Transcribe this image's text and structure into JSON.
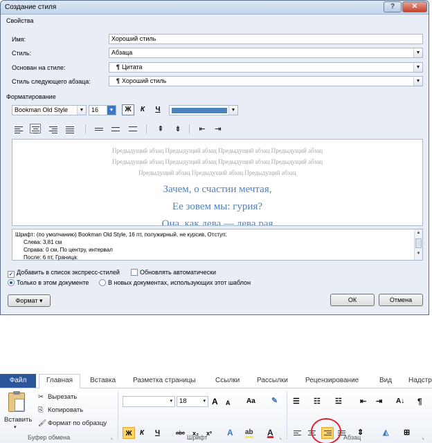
{
  "dialog": {
    "title": "Создание стиля",
    "help_label": "?",
    "close_label": "✕",
    "properties_group": "Свойства",
    "fields": {
      "name_label": "Имя:",
      "name_value": "Хороший стиль",
      "style_label": "Стиль:",
      "style_value": "Абзаца",
      "based_label": "Основан на стиле:",
      "based_value": "Цитата",
      "next_label": "Стиль следующего абзаца:",
      "next_value": "Хороший стиль"
    },
    "formatting_group": "Форматирование",
    "font_name": "Bookman Old Style",
    "font_size": "16",
    "bold_label": "Ж",
    "italic_label": "К",
    "underline_label": "Ч",
    "font_color": "#4f81bd",
    "preview": {
      "previous_lines": [
        "Предыдущий абзац Предыдущий абзац Предыдущий абзац Предыдущий абзац",
        "Предыдущий абзац Предыдущий абзац Предыдущий абзац Предыдущий абзац",
        "Предыдущий абзац Предыдущий абзац Предыдущий абзац"
      ],
      "poem_lines": [
        "Зачем, о счастии мечтая,",
        "Ее зовем мы: гурия?",
        "Она, как дева — дева рая"
      ]
    },
    "description_lines": [
      "Шрифт: (по умолчанию) Bookman Old Style, 16 пт, полужирный, не курсив, Отступ:",
      "Слева:  3,81 см",
      "Справа:  0 см, По центру, интервал",
      "После:  6 пт, Граница:"
    ],
    "add_quick_styles": "Добавить в список экспресс-стилей",
    "auto_update": "Обновлять автоматически",
    "only_this_doc": "Только в этом документе",
    "new_docs": "В новых документах, использующих этот шаблон",
    "format_button": "Формат ▾",
    "ok_button": "ОК",
    "cancel_button": "Отмена"
  },
  "ribbon": {
    "tabs": [
      "Файл",
      "Главная",
      "Вставка",
      "Разметка страницы",
      "Ссылки",
      "Рассылки",
      "Рецензирование",
      "Вид",
      "Надстр"
    ],
    "clipboard": {
      "paste": "Вставить",
      "cut": "Вырезать",
      "copy": "Копировать",
      "format_painter": "Формат по образцу",
      "group_label": "Буфер обмена"
    },
    "font": {
      "font_name": "",
      "font_size": "18",
      "grow": "A",
      "shrink": "A",
      "case": "Aa",
      "bold": "Ж",
      "italic": "К",
      "underline": "Ч",
      "strike": "abc",
      "subscript": "x₂",
      "superscript": "x²",
      "group_label": "Шрифт"
    },
    "paragraph": {
      "group_label": "Абзац",
      "pilcrow": "¶",
      "sort": "A↓"
    }
  }
}
